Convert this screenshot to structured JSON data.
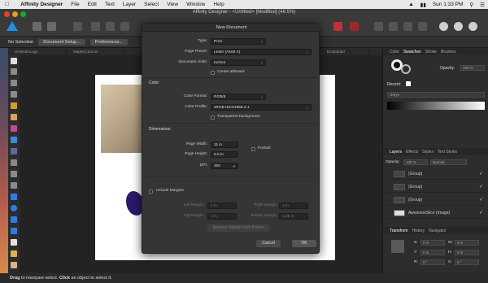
{
  "menubar": {
    "app_name": "Affinity Designer",
    "items": [
      "File",
      "Edit",
      "Text",
      "Layer",
      "Select",
      "View",
      "Window",
      "Help"
    ],
    "clock": "Sun 1:33 PM"
  },
  "window": {
    "title": "Affinity Designer - <Untitled> [Modified] (48.5%)"
  },
  "context_bar": {
    "selection": "No Selection",
    "doc_setup": "Document Setup...",
    "preferences": "Preferences..."
  },
  "doc_tabs": [
    "OnWorksLogo",
    "MapleyCartoon",
    "",
    "Embedded"
  ],
  "status": {
    "text1": "Drag",
    "text2": " to marquee select. ",
    "text3": "Click",
    "text4": " an object to select it."
  },
  "right_panel": {
    "tabs": [
      "Color",
      "Swatches",
      "Stroke",
      "Brushes"
    ],
    "opacity_label": "Opacity:",
    "opacity_value": "100 %",
    "recent_label": "Recent:",
    "palette": "Greys",
    "layers_tabs": [
      "Layers",
      "Effects",
      "Styles",
      "Text Styles"
    ],
    "layers_opacity_label": "Opacity:",
    "layers_opacity": "100 %",
    "blend": "Normal",
    "layers": [
      "(Group)",
      "(Group)",
      "(Group)",
      "AwesomeSlice (Image)"
    ],
    "transform_tabs": [
      "Transform",
      "History",
      "Navigator"
    ],
    "t_x_label": "X:",
    "t_x": "0 in",
    "t_y_label": "Y:",
    "t_y": "0 in",
    "t_w_label": "W:",
    "t_w": "0 in",
    "t_h_label": "H:",
    "t_h": "0 in",
    "t_r_label": "R:",
    "t_r": "0 °",
    "t_s_label": "S:",
    "t_s": "0 °"
  },
  "dialog": {
    "title": "New Document",
    "type_label": "Type:",
    "type_value": "Print",
    "preset_label": "Page Preset:",
    "preset_value": "Letter (ANSI A)",
    "units_label": "Document Units:",
    "units_value": "Inches",
    "artboard_label": "Create artboard",
    "color_section": "Color:",
    "color_format_label": "Color Format:",
    "color_format_value": "RGB/8",
    "color_profile_label": "Color Profile:",
    "color_profile_value": "sRGB IEC61966-2.1",
    "transparent_label": "Transparent background",
    "dimensions_section": "Dimensions:",
    "width_label": "Page Width:",
    "width_value": "11 in",
    "height_label": "Page Height:",
    "height_value": "8.5 in",
    "dpi_label": "DPI:",
    "dpi_value": "300",
    "portrait_label": "Portrait",
    "margins_label": "Include Margins",
    "left_margin_label": "Left Margin:",
    "left_margin_value": "1 in",
    "right_margin_label": "Right Margin:",
    "right_margin_value": "1 in",
    "top_margin_label": "Top Margin:",
    "top_margin_value": "1 in",
    "bottom_margin_label": "Bottom Margin:",
    "bottom_margin_value": "1.25 in",
    "retrieve_label": "Retrieve Margin from Printer",
    "cancel_label": "Cancel",
    "ok_label": "OK"
  }
}
